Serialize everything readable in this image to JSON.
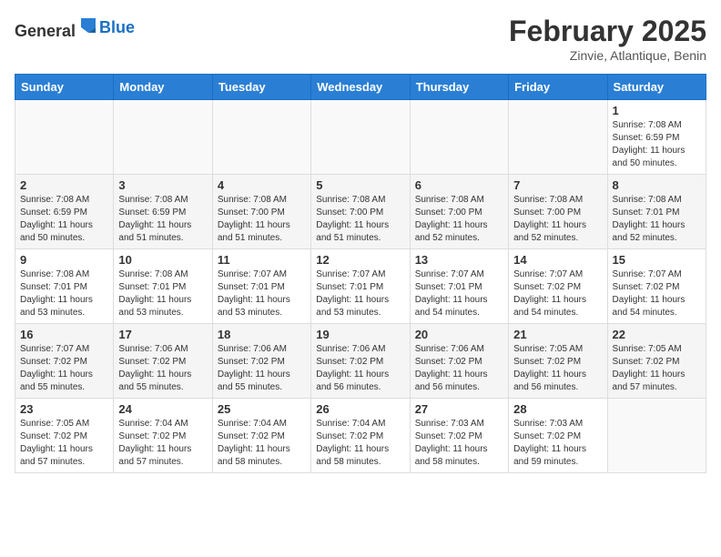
{
  "header": {
    "logo": {
      "general": "General",
      "blue": "Blue"
    },
    "title": "February 2025",
    "location": "Zinvie, Atlantique, Benin"
  },
  "weekdays": [
    "Sunday",
    "Monday",
    "Tuesday",
    "Wednesday",
    "Thursday",
    "Friday",
    "Saturday"
  ],
  "weeks": [
    [
      {
        "day": "",
        "info": ""
      },
      {
        "day": "",
        "info": ""
      },
      {
        "day": "",
        "info": ""
      },
      {
        "day": "",
        "info": ""
      },
      {
        "day": "",
        "info": ""
      },
      {
        "day": "",
        "info": ""
      },
      {
        "day": "1",
        "info": "Sunrise: 7:08 AM\nSunset: 6:59 PM\nDaylight: 11 hours\nand 50 minutes."
      }
    ],
    [
      {
        "day": "2",
        "info": "Sunrise: 7:08 AM\nSunset: 6:59 PM\nDaylight: 11 hours\nand 50 minutes."
      },
      {
        "day": "3",
        "info": "Sunrise: 7:08 AM\nSunset: 6:59 PM\nDaylight: 11 hours\nand 51 minutes."
      },
      {
        "day": "4",
        "info": "Sunrise: 7:08 AM\nSunset: 7:00 PM\nDaylight: 11 hours\nand 51 minutes."
      },
      {
        "day": "5",
        "info": "Sunrise: 7:08 AM\nSunset: 7:00 PM\nDaylight: 11 hours\nand 51 minutes."
      },
      {
        "day": "6",
        "info": "Sunrise: 7:08 AM\nSunset: 7:00 PM\nDaylight: 11 hours\nand 52 minutes."
      },
      {
        "day": "7",
        "info": "Sunrise: 7:08 AM\nSunset: 7:00 PM\nDaylight: 11 hours\nand 52 minutes."
      },
      {
        "day": "8",
        "info": "Sunrise: 7:08 AM\nSunset: 7:01 PM\nDaylight: 11 hours\nand 52 minutes."
      }
    ],
    [
      {
        "day": "9",
        "info": "Sunrise: 7:08 AM\nSunset: 7:01 PM\nDaylight: 11 hours\nand 53 minutes."
      },
      {
        "day": "10",
        "info": "Sunrise: 7:08 AM\nSunset: 7:01 PM\nDaylight: 11 hours\nand 53 minutes."
      },
      {
        "day": "11",
        "info": "Sunrise: 7:07 AM\nSunset: 7:01 PM\nDaylight: 11 hours\nand 53 minutes."
      },
      {
        "day": "12",
        "info": "Sunrise: 7:07 AM\nSunset: 7:01 PM\nDaylight: 11 hours\nand 53 minutes."
      },
      {
        "day": "13",
        "info": "Sunrise: 7:07 AM\nSunset: 7:01 PM\nDaylight: 11 hours\nand 54 minutes."
      },
      {
        "day": "14",
        "info": "Sunrise: 7:07 AM\nSunset: 7:02 PM\nDaylight: 11 hours\nand 54 minutes."
      },
      {
        "day": "15",
        "info": "Sunrise: 7:07 AM\nSunset: 7:02 PM\nDaylight: 11 hours\nand 54 minutes."
      }
    ],
    [
      {
        "day": "16",
        "info": "Sunrise: 7:07 AM\nSunset: 7:02 PM\nDaylight: 11 hours\nand 55 minutes."
      },
      {
        "day": "17",
        "info": "Sunrise: 7:06 AM\nSunset: 7:02 PM\nDaylight: 11 hours\nand 55 minutes."
      },
      {
        "day": "18",
        "info": "Sunrise: 7:06 AM\nSunset: 7:02 PM\nDaylight: 11 hours\nand 55 minutes."
      },
      {
        "day": "19",
        "info": "Sunrise: 7:06 AM\nSunset: 7:02 PM\nDaylight: 11 hours\nand 56 minutes."
      },
      {
        "day": "20",
        "info": "Sunrise: 7:06 AM\nSunset: 7:02 PM\nDaylight: 11 hours\nand 56 minutes."
      },
      {
        "day": "21",
        "info": "Sunrise: 7:05 AM\nSunset: 7:02 PM\nDaylight: 11 hours\nand 56 minutes."
      },
      {
        "day": "22",
        "info": "Sunrise: 7:05 AM\nSunset: 7:02 PM\nDaylight: 11 hours\nand 57 minutes."
      }
    ],
    [
      {
        "day": "23",
        "info": "Sunrise: 7:05 AM\nSunset: 7:02 PM\nDaylight: 11 hours\nand 57 minutes."
      },
      {
        "day": "24",
        "info": "Sunrise: 7:04 AM\nSunset: 7:02 PM\nDaylight: 11 hours\nand 57 minutes."
      },
      {
        "day": "25",
        "info": "Sunrise: 7:04 AM\nSunset: 7:02 PM\nDaylight: 11 hours\nand 58 minutes."
      },
      {
        "day": "26",
        "info": "Sunrise: 7:04 AM\nSunset: 7:02 PM\nDaylight: 11 hours\nand 58 minutes."
      },
      {
        "day": "27",
        "info": "Sunrise: 7:03 AM\nSunset: 7:02 PM\nDaylight: 11 hours\nand 58 minutes."
      },
      {
        "day": "28",
        "info": "Sunrise: 7:03 AM\nSunset: 7:02 PM\nDaylight: 11 hours\nand 59 minutes."
      },
      {
        "day": "",
        "info": ""
      }
    ]
  ]
}
